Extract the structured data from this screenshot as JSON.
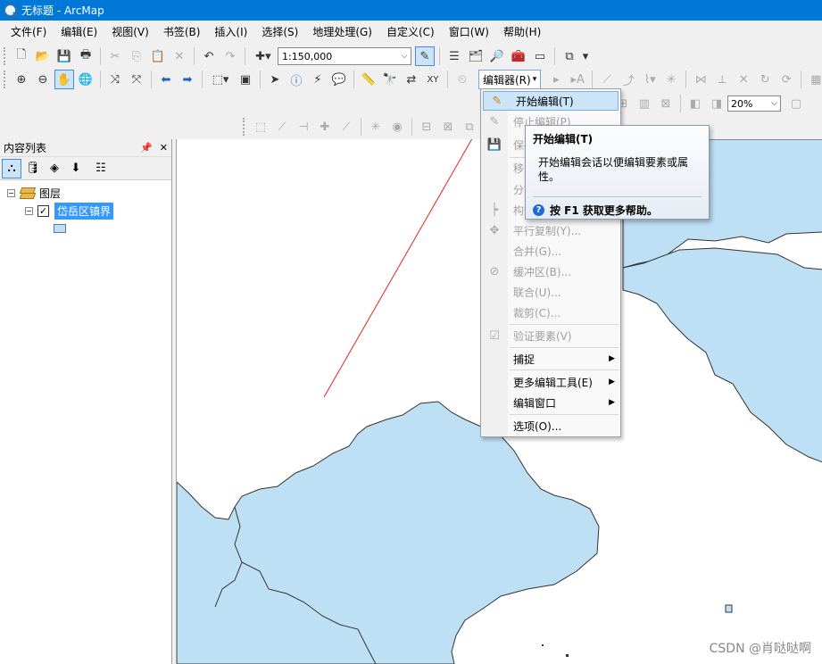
{
  "window": {
    "title": "无标题 - ArcMap"
  },
  "menubar": [
    "文件(F)",
    "编辑(E)",
    "视图(V)",
    "书签(B)",
    "插入(I)",
    "选择(S)",
    "地理处理(G)",
    "自定义(C)",
    "窗口(W)",
    "帮助(H)"
  ],
  "toolbar": {
    "scale": "1:150,000",
    "editor_button": "编辑器(R)",
    "zoom_percent": "20%"
  },
  "toc": {
    "title": "内容列表",
    "root_label": "图层",
    "layer_name": "岱岳区镇界"
  },
  "editor_menu": {
    "items": [
      {
        "label": "开始编辑(T)",
        "icon": "pencil-icon"
      },
      {
        "label": "停止编辑(P)",
        "icon": "stop-edit-icon"
      },
      {
        "label": "保存编辑内容(S)",
        "icon": "save-edits-icon"
      },
      {
        "label": "移动(M)...",
        "icon": ""
      },
      {
        "label": "分割(I)...",
        "icon": ""
      },
      {
        "label": "构造点(O)...",
        "icon": "construct-points-icon"
      },
      {
        "label": "平行复制(Y)...",
        "icon": "copy-parallel-icon"
      },
      {
        "label": "合并(G)...",
        "icon": ""
      },
      {
        "label": "缓冲区(B)...",
        "icon": "buffer-icon"
      },
      {
        "label": "联合(U)...",
        "icon": ""
      },
      {
        "label": "裁剪(C)...",
        "icon": ""
      },
      {
        "label": "验证要素(V)",
        "icon": "validate-icon"
      },
      {
        "label": "捕捉",
        "icon": ""
      },
      {
        "label": "更多编辑工具(E)",
        "icon": ""
      },
      {
        "label": "编辑窗口",
        "icon": ""
      },
      {
        "label": "选项(O)...",
        "icon": ""
      }
    ]
  },
  "tooltip": {
    "title": "开始编辑(T)",
    "body": "开始编辑会话以便编辑要素或属性。",
    "help": "按 F1 获取更多帮助。"
  },
  "watermark": "CSDN @肖哒哒啊",
  "colors": {
    "titlebar": "#0078d7",
    "map_fill": "#bee0f5",
    "annotation_arrow": "#e82020"
  }
}
